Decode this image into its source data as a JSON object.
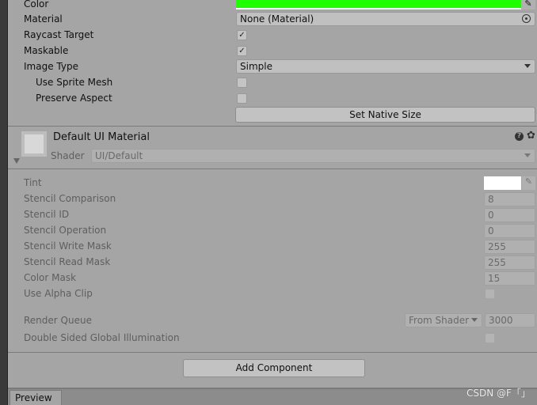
{
  "image": {
    "color_label": "Color",
    "color_value": "#1eff00",
    "material_label": "Material",
    "material_value": "None (Material)",
    "raycast_label": "Raycast Target",
    "raycast_checked": true,
    "maskable_label": "Maskable",
    "maskable_checked": true,
    "image_type_label": "Image Type",
    "image_type_value": "Simple",
    "use_sprite_mesh_label": "Use Sprite Mesh",
    "use_sprite_mesh_checked": false,
    "preserve_aspect_label": "Preserve Aspect",
    "preserve_aspect_checked": false,
    "set_native_size": "Set Native Size"
  },
  "material": {
    "title": "Default UI Material",
    "shader_label": "Shader",
    "shader_value": "UI/Default",
    "props": [
      {
        "label": "Tint",
        "value": "#ffffff"
      },
      {
        "label": "Stencil Comparison",
        "value": "8"
      },
      {
        "label": "Stencil ID",
        "value": "0"
      },
      {
        "label": "Stencil Operation",
        "value": "0"
      },
      {
        "label": "Stencil Write Mask",
        "value": "255"
      },
      {
        "label": "Stencil Read Mask",
        "value": "255"
      },
      {
        "label": "Color Mask",
        "value": "15"
      },
      {
        "label": "Use Alpha Clip",
        "value": false
      }
    ],
    "render_queue_label": "Render Queue",
    "render_queue_mode": "From Shader",
    "render_queue_value": "3000",
    "dsgi_label": "Double Sided Global Illumination",
    "dsgi_checked": false
  },
  "add_component": "Add Component",
  "preview_tab": "Preview",
  "watermark": "CSDN @F「」"
}
